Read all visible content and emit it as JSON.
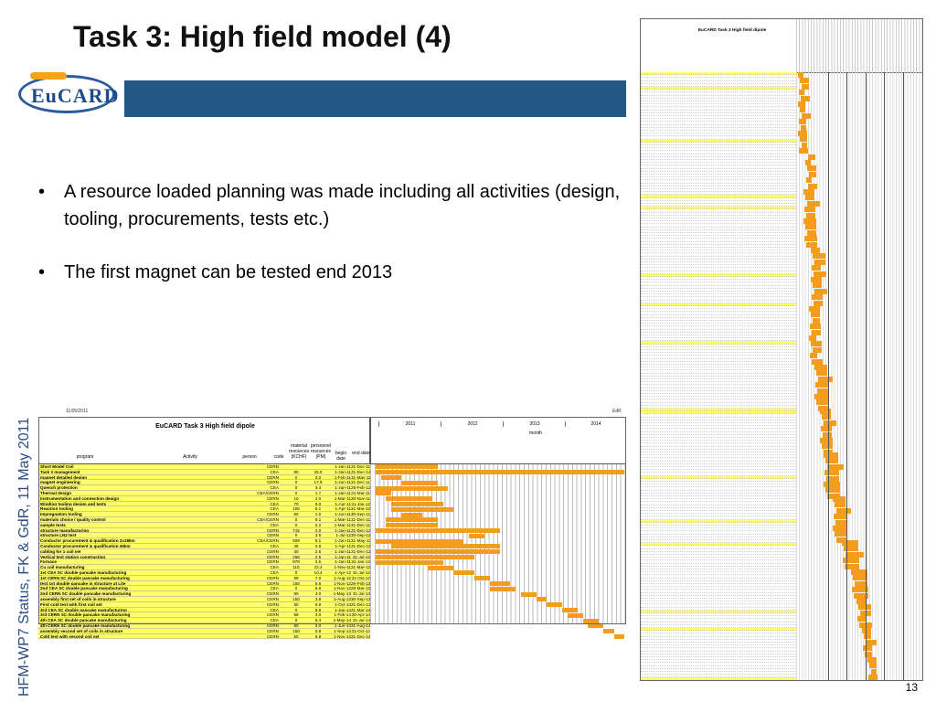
{
  "slide": {
    "title": "Task 3: High field model (4)",
    "logo_text": "EuCARD",
    "bullets": [
      "A resource loaded planning was made including all activities (design, tooling, procurements, tests etc.)",
      "The first magnet can be tested end 2013"
    ],
    "footer_vertical": "HFM-WP7 Status, FK & GdR, 11 May 2011",
    "page_number": "13"
  },
  "plan_table": {
    "date": "11/05/2011",
    "edr": "EdR",
    "title": "EuCARD Task 3 High field dipole",
    "columns": {
      "program": "program",
      "activity": "Activity",
      "person": "person",
      "code": "code",
      "material": "material resources (KCHF)",
      "personnel": "personnel resources (PM)",
      "begin": "begin date",
      "end": "end date"
    },
    "years": [
      "2011",
      "2012",
      "2013",
      "2014"
    ],
    "month_label": "month",
    "rows": [
      {
        "name": "Short Model Coil",
        "person": "CERN",
        "mat": "",
        "pers": "",
        "begin": "1-Jan-11",
        "end": "31-Dec-11",
        "yellow": true
      },
      {
        "name": "Task 3 management",
        "person": "CEA",
        "mat": "80",
        "pers": "25.0",
        "begin": "1-Jan-11",
        "end": "31-Dec-14",
        "yellow": true
      },
      {
        "name": "magnet detailed design",
        "person": "CERN",
        "mat": "0",
        "pers": "3.0",
        "begin": "1-Feb-11",
        "end": "31-May-11",
        "yellow": true
      },
      {
        "name": "magnet engineering",
        "person": "CERN",
        "mat": "0",
        "pers": "17.9",
        "begin": "1-Jun-11",
        "end": "31-Dec-11",
        "yellow": true
      },
      {
        "name": "Quench protection",
        "person": "CEA",
        "mat": "0",
        "pers": "3.4",
        "begin": "1-Jan-11",
        "end": "29-Feb-12",
        "yellow": true
      },
      {
        "name": "Thermal design",
        "person": "CEA/CERN",
        "mat": "0",
        "pers": "1.7",
        "begin": "1-Jan-11",
        "end": "31-Mar-11",
        "yellow": true
      },
      {
        "name": "Instrumentation and connection design",
        "person": "CERN",
        "mat": "10",
        "pers": "2.0",
        "begin": "1-Mar-11",
        "end": "30-Nov-11",
        "yellow": true
      },
      {
        "name": "Winding tooling design and tests",
        "person": "CEA",
        "mat": "70",
        "pers": "6.0",
        "begin": "1-Apr-11",
        "end": "31-Jan-12",
        "yellow": true
      },
      {
        "name": "Reaction tooling",
        "person": "CEA",
        "mat": "106",
        "pers": "6.1",
        "begin": "1-Apr-11",
        "end": "31-Mar-12",
        "yellow": true
      },
      {
        "name": "Impregnation tooling",
        "person": "CERN",
        "mat": "50",
        "pers": "1.0",
        "begin": "1-Jun-11",
        "end": "30-Sep-11",
        "yellow": true
      },
      {
        "name": "materials choice / quality control",
        "person": "CEA/CERN",
        "mat": "0",
        "pers": "6.1",
        "begin": "1-Mar-11",
        "end": "31-Dec-11",
        "yellow": true
      },
      {
        "name": "sample tests",
        "person": "CEA",
        "mat": "0",
        "pers": "3.2",
        "begin": "1-Mar-11",
        "end": "31-Dec-11",
        "yellow": true
      },
      {
        "name": "structure manufacturing",
        "person": "CERN",
        "mat": "715",
        "pers": "2.0",
        "begin": "1-Jan-11",
        "end": "31-Dec-12",
        "yellow": true
      },
      {
        "name": "structure LN2 test",
        "person": "CERN",
        "mat": "0",
        "pers": "3.5",
        "begin": "1-Jul-12",
        "end": "30-Sep-12",
        "yellow": true
      },
      {
        "name": "Conductor procurement & qualification 2x18km",
        "person": "CEA/CERN",
        "mat": "609",
        "pers": "5.1",
        "begin": "1-Jan-11",
        "end": "31-May-12",
        "yellow": true
      },
      {
        "name": "Conductor procurement & qualification 45km",
        "person": "CEA",
        "mat": "46",
        "pers": "4.8",
        "begin": "1-Apr-11",
        "end": "31-Dec-12",
        "yellow": true
      },
      {
        "name": "cabling for 1 coil set",
        "person": "CERN",
        "mat": "30",
        "pers": "2.5",
        "begin": "1-Jan-11",
        "end": "31-Dec-12",
        "yellow": true
      },
      {
        "name": "Vertical test station construction",
        "person": "CERN",
        "mat": "268",
        "pers": "2.5",
        "begin": "1-Jan-11",
        "end": "31-Jul-12",
        "yellow": true
      },
      {
        "name": "Furnace",
        "person": "CERN",
        "mat": "978",
        "pers": "3.5",
        "begin": "1-Jan-11",
        "end": "31-Jan-12",
        "yellow": true
      },
      {
        "name": "Cu coil manufacturing",
        "person": "CEA",
        "mat": "115",
        "pers": "22.4",
        "begin": "1-Nov-11",
        "end": "31-Mar-12",
        "yellow": true
      },
      {
        "name": "1st CEA SC double pancake manufacturing",
        "person": "CEA",
        "mat": "0",
        "pers": "10.4",
        "begin": "1-Apr-12",
        "end": "31-Jul-12",
        "yellow": true
      },
      {
        "name": "1st CERN SC double pancake manufacturing",
        "person": "CERN",
        "mat": "99",
        "pers": "7.0",
        "begin": "1-Aug-12",
        "end": "31-Oct-12",
        "yellow": true
      },
      {
        "name": "test 1st double pancake in structure at Lite",
        "person": "CERN",
        "mat": "158",
        "pers": "5.5",
        "begin": "1-Nov-12",
        "end": "28-Feb-13",
        "yellow": true
      },
      {
        "name": "2nd CEA SC double pancake manufacturing",
        "person": "CEA",
        "mat": "0",
        "pers": "5.6",
        "begin": "1-Nov-12",
        "end": "28-Mar-13",
        "yellow": true
      },
      {
        "name": "2nd CERN SC double pancake manufacturing",
        "person": "CERN",
        "mat": "90",
        "pers": "3.0",
        "begin": "1-May-13",
        "end": "31-Jul-13",
        "yellow": true
      },
      {
        "name": "assembly first set of coils in structure",
        "person": "CERN",
        "mat": "150",
        "pers": "3.8",
        "begin": "1-Aug-13",
        "end": "30-Sep-13",
        "yellow": true
      },
      {
        "name": "First cold test with first coil set",
        "person": "CERN",
        "mat": "50",
        "pers": "6.8",
        "begin": "1-Oct-13",
        "end": "31-Dec-13",
        "yellow": true
      },
      {
        "name": "3rd CEA SC double pancake manufacturing",
        "person": "CEA",
        "mat": "0",
        "pers": "5.6",
        "begin": "1-Jan-14",
        "end": "31-Mar-14",
        "yellow": true
      },
      {
        "name": "3rd CERN SC double pancake manufacturing",
        "person": "CERN",
        "mat": "99",
        "pers": "3.0",
        "begin": "1-Feb-14",
        "end": "30-Apr-14",
        "yellow": true
      },
      {
        "name": "4th CEA SC double pancake manufacturing",
        "person": "CEA",
        "mat": "0",
        "pers": "5.4",
        "begin": "1-May-14",
        "end": "31-Jul-14",
        "yellow": true
      },
      {
        "name": "4th CERN SC double pancake manufacturing",
        "person": "CERN",
        "mat": "90",
        "pers": "3.0",
        "begin": "1-Jun-14",
        "end": "31-Aug-14",
        "yellow": true
      },
      {
        "name": "assembly second set of coils in structure",
        "person": "CERN",
        "mat": "150",
        "pers": "3.8",
        "begin": "1-Sep-14",
        "end": "31-Oct-14",
        "yellow": true
      },
      {
        "name": "Cold test with second coil set",
        "person": "CERN",
        "mat": "50",
        "pers": "6.8",
        "begin": "1-Nov-14",
        "end": "31-Dec-14",
        "yellow": true
      }
    ]
  },
  "detail_plan": {
    "title": "EuCARD Task 3 High field dipole"
  }
}
